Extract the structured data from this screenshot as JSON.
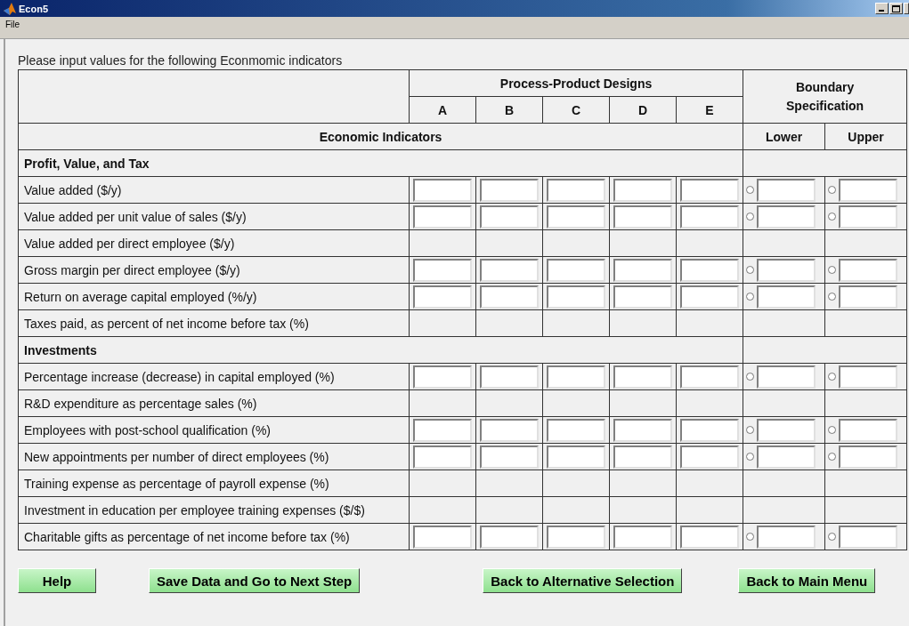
{
  "window": {
    "title": "Econ5"
  },
  "menu": [
    "File"
  ],
  "instruction": "Please input values for the following Econmomic indicators",
  "table": {
    "group_heading": "Process-Product Designs",
    "designs": [
      "A",
      "B",
      "C",
      "D",
      "E"
    ],
    "boundary_heading": "Boundary Specification",
    "indicator_heading": "Economic Indicators",
    "lower_heading": "Lower",
    "upper_heading": "Upper",
    "rows": [
      {
        "kind": "section",
        "label": "Profit, Value, and Tax"
      },
      {
        "kind": "input",
        "label": "Value added ($/y)",
        "lower": {
          "selected": false
        },
        "upper": {
          "selected": false
        }
      },
      {
        "kind": "input",
        "label": "Value added per unit value of sales ($/y)",
        "lower": {
          "selected": false
        },
        "upper": {
          "selected": false
        }
      },
      {
        "kind": "blank",
        "label": "Value added per direct employee ($/y)"
      },
      {
        "kind": "input",
        "label": "Gross margin per direct employee ($/y)",
        "lower": {
          "selected": false
        },
        "upper": {
          "selected": false
        }
      },
      {
        "kind": "input",
        "label": "Return on average capital employed (%/y)",
        "lower": {
          "selected": false
        },
        "upper": {
          "selected": false
        }
      },
      {
        "kind": "blank",
        "label": "Taxes paid, as percent of net income before tax (%)"
      },
      {
        "kind": "section",
        "label": "Investments"
      },
      {
        "kind": "input",
        "label": "Percentage increase (decrease) in capital employed (%)",
        "lower": {
          "selected": false
        },
        "upper": {
          "selected": false
        }
      },
      {
        "kind": "blank",
        "label": "R&D expenditure as percentage sales (%)"
      },
      {
        "kind": "input",
        "label": "Employees with post-school qualification (%)",
        "lower": {
          "selected": false
        },
        "upper": {
          "selected": false
        }
      },
      {
        "kind": "input",
        "label": "New appointments per number of direct employees (%)",
        "lower": {
          "selected": false
        },
        "upper": {
          "selected": false
        }
      },
      {
        "kind": "blank",
        "label": "Training expense as percentage of payroll expense (%)"
      },
      {
        "kind": "blank",
        "label": "Investment in education per employee training expenses ($/$)"
      },
      {
        "kind": "input",
        "label": "Charitable gifts as percentage of net income  before tax (%)",
        "lower": {
          "selected": false
        },
        "upper": {
          "selected": false
        }
      }
    ]
  },
  "buttons": [
    "Help",
    "Save Data and Go to Next Step",
    "Back to Alternative Selection",
    "Back to Main Menu"
  ]
}
